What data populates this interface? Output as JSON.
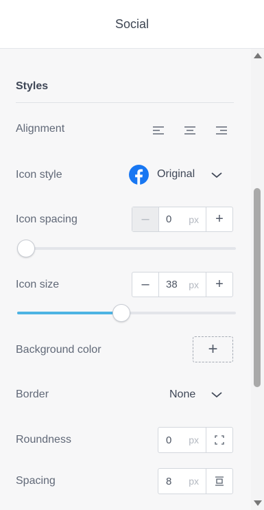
{
  "header": {
    "title": "Social"
  },
  "styles": {
    "title": "Styles",
    "alignment": {
      "label": "Alignment"
    },
    "icon_style": {
      "label": "Icon style",
      "value": "Original",
      "icon": "facebook-icon"
    },
    "icon_spacing": {
      "label": "Icon spacing",
      "value": "0",
      "unit": "px",
      "slider_fraction": 0.0
    },
    "icon_size": {
      "label": "Icon size",
      "value": "38",
      "unit": "px",
      "slider_fraction": 0.47
    },
    "background_color": {
      "label": "Background color"
    },
    "border": {
      "label": "Border",
      "value": "None"
    },
    "roundness": {
      "label": "Roundness",
      "value": "0",
      "unit": "px"
    },
    "spacing": {
      "label": "Spacing",
      "value": "8",
      "unit": "px"
    }
  },
  "colors": {
    "accent": "#4db3e3",
    "facebook": "#1877f2"
  }
}
